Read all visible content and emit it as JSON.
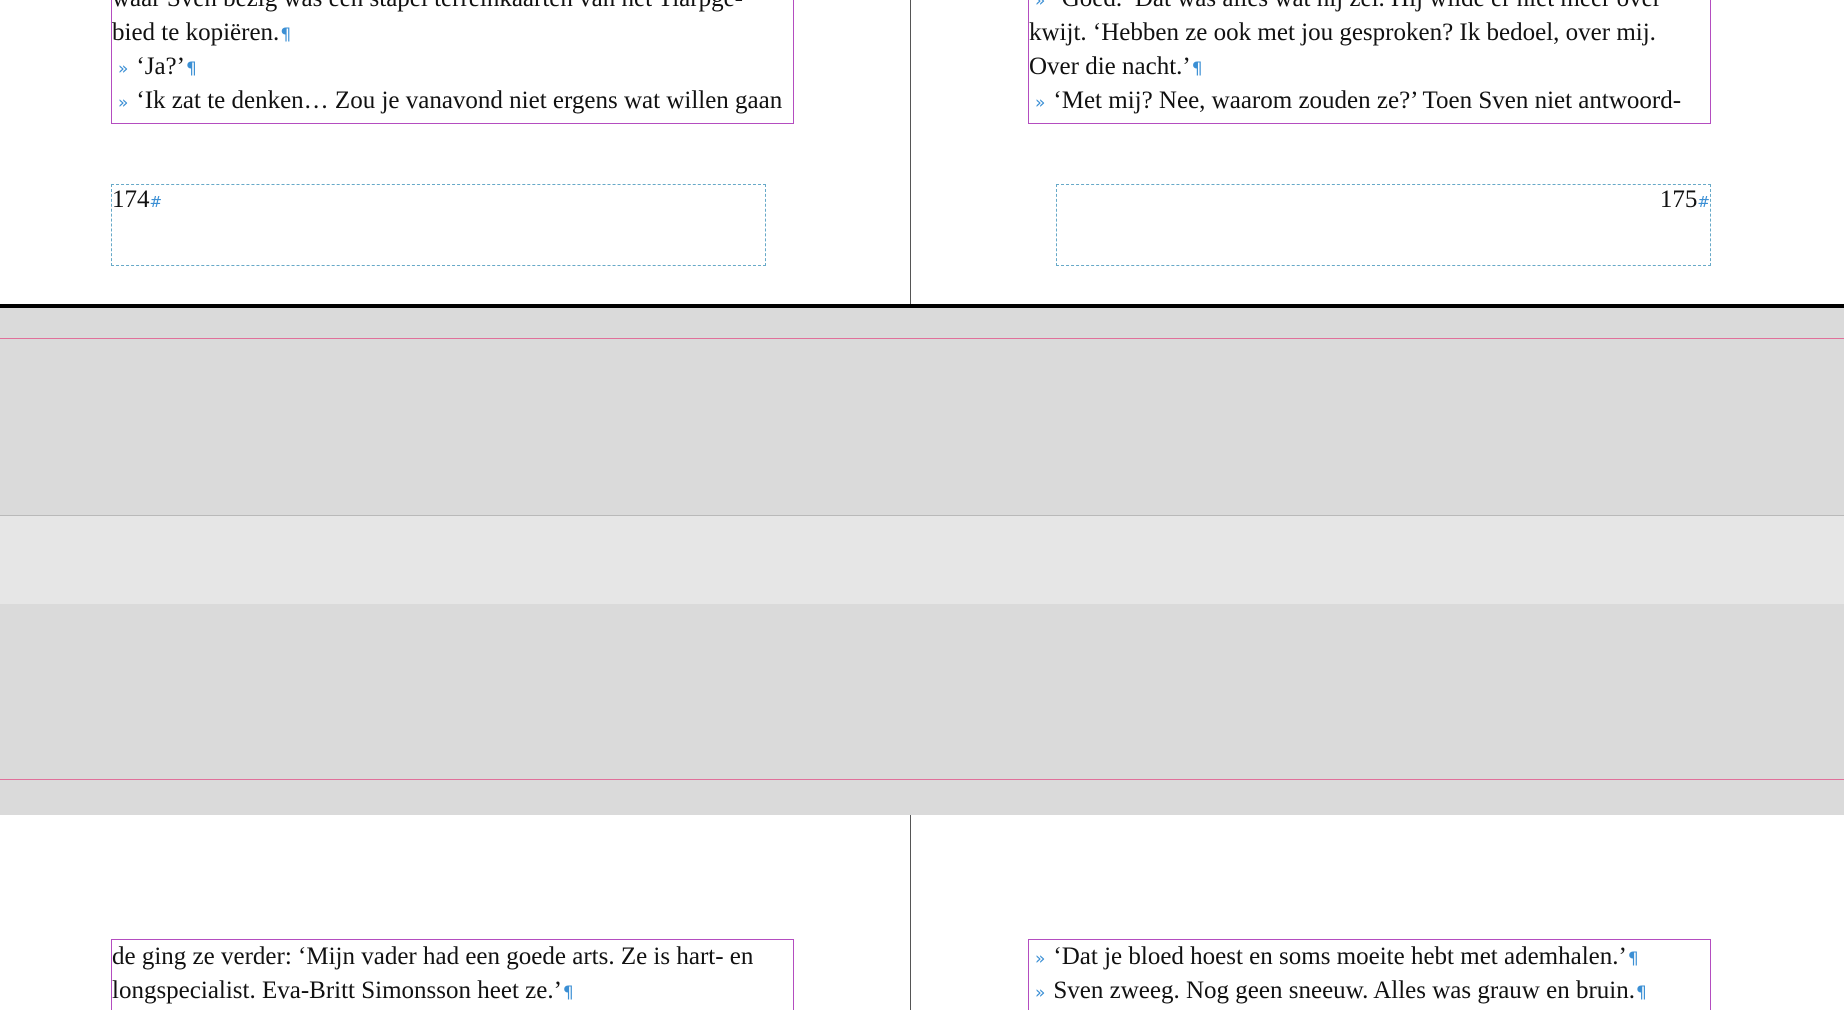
{
  "pages": {
    "left_top": {
      "lines": [
        {
          "indent": false,
          "text": "waar Sven bezig was een stapel terreinkaarten van het Tiarpge-",
          "end": ""
        },
        {
          "indent": false,
          "text": "bied te kopiëren.",
          "end": "¶"
        },
        {
          "indent": true,
          "text": "‘Ja?’",
          "end": "¶"
        },
        {
          "indent": true,
          "text": "‘Ik zat te denken… Zou je vanavond niet ergens wat willen gaan",
          "end": ""
        }
      ],
      "folio": "174"
    },
    "right_top": {
      "lines": [
        {
          "indent": true,
          "text": "‘Goed.’ Dat was alles wat hij zei. Hij wilde er niet meer over",
          "end": ""
        },
        {
          "indent": false,
          "text": "kwijt. ‘Hebben ze ook met jou gesproken? Ik bedoel, over mij.",
          "end": ""
        },
        {
          "indent": false,
          "text": "Over die nacht.’",
          "end": "¶"
        },
        {
          "indent": true,
          "text": "‘Met mij? Nee, waarom zouden ze?’ Toen Sven niet antwoord-",
          "end": ""
        }
      ],
      "folio": "175"
    },
    "left_bottom": {
      "lines": [
        {
          "indent": false,
          "text": "de ging ze verder: ‘Mijn vader had een goede arts. Ze is hart- en",
          "end": ""
        },
        {
          "indent": false,
          "text": "longspecialist. Eva-Britt Simonsson heet ze.’",
          "end": "¶"
        }
      ]
    },
    "right_bottom": {
      "lines": [
        {
          "indent": true,
          "text": "‘Dat je bloed hoest en soms moeite hebt met ademhalen.’",
          "end": "¶"
        },
        {
          "indent": true,
          "text": "Sven zweeg. Nog geen sneeuw. Alles was grauw en bruin.",
          "end": "¶"
        }
      ]
    }
  },
  "glyphs": {
    "tab": "»",
    "folio_marker": "#"
  },
  "colors": {
    "frame_border": "#b44dc0",
    "hidden_chars": "#3b8fd4",
    "bleed_line": "#e0709a",
    "pasteboard": "#dadada"
  }
}
